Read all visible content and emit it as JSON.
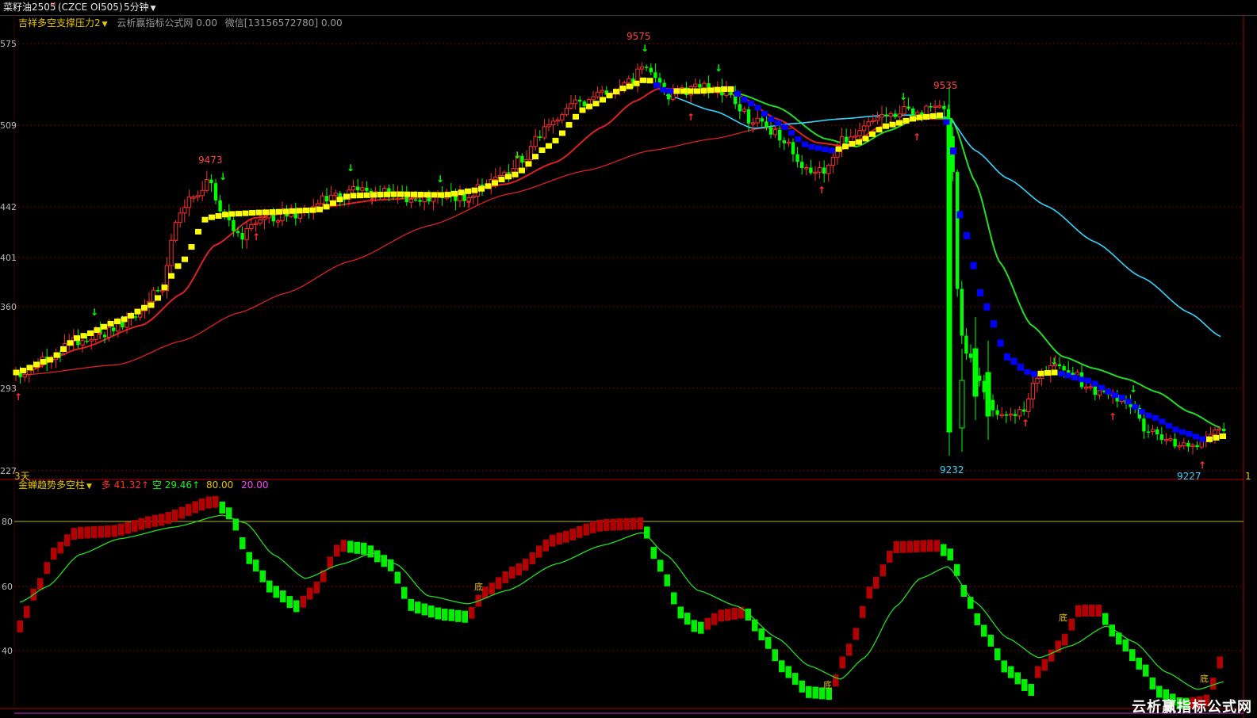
{
  "title_bar": {
    "instrument": "菜籽油2505",
    "marker": "M",
    "code": "(CZCE OI505)",
    "period": "5分钟"
  },
  "main_panel": {
    "indicator_name": "吉祥多空支撑压力2",
    "source_label": "云析赢指标公式网",
    "source_value": "0.00",
    "wechat_label": "微信[13156572780]",
    "wechat_value": "0.00",
    "y_labels": [
      "575",
      "509",
      "442",
      "401",
      "360",
      "293",
      "227"
    ],
    "date_label": "3天",
    "right_edge_label": "1",
    "annotations": [
      {
        "text": "9473",
        "color": "#ff4040"
      },
      {
        "text": "9575",
        "color": "#ff4040"
      },
      {
        "text": "9535",
        "color": "#ff4040"
      },
      {
        "text": "9232",
        "color": "#33d6ff"
      },
      {
        "text": "9227",
        "color": "#33d6ff"
      }
    ]
  },
  "sub_panel": {
    "indicator_name": "金蝉趋势多空柱",
    "long_label": "多",
    "long_value": "41.32",
    "short_label": "空",
    "short_value": "29.46",
    "level_high": "80.00",
    "level_low": "20.00",
    "y_labels": [
      "80",
      "60",
      "40"
    ],
    "bottom_marker": "底"
  },
  "colors": {
    "up": "#ff2e2e",
    "down": "#00ff00",
    "yellow": "#ffff00",
    "blue": "#0000ff",
    "cyan": "#33d6ff",
    "ma_red": "#e02020",
    "ma_green": "#22dd22",
    "osc_up": "#b30000",
    "osc_down": "#00ee00"
  },
  "watermark": "云析赢指标公式网"
}
